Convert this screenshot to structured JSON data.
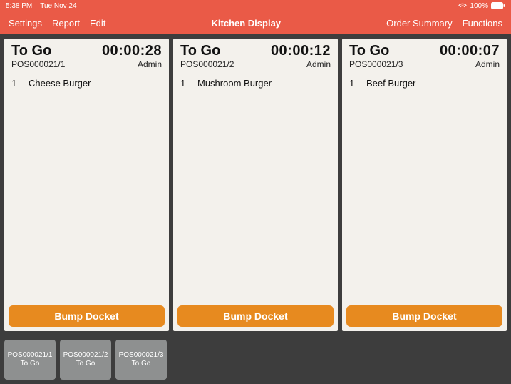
{
  "status": {
    "time": "5:38 PM",
    "date": "Tue Nov 24",
    "battery": "100%"
  },
  "nav": {
    "left": {
      "settings": "Settings",
      "report": "Report",
      "edit": "Edit"
    },
    "title": "Kitchen Display",
    "right": {
      "order_summary": "Order Summary",
      "functions": "Functions"
    }
  },
  "dockets": [
    {
      "type": "To Go",
      "timer": "00:00:28",
      "ref": "POS000021/1",
      "staff": "Admin",
      "items": [
        {
          "qty": "1",
          "name": "Cheese Burger"
        }
      ],
      "button": "Bump Docket"
    },
    {
      "type": "To Go",
      "timer": "00:00:12",
      "ref": "POS000021/2",
      "staff": "Admin",
      "items": [
        {
          "qty": "1",
          "name": "Mushroom Burger"
        }
      ],
      "button": "Bump Docket"
    },
    {
      "type": "To Go",
      "timer": "00:00:07",
      "ref": "POS000021/3",
      "staff": "Admin",
      "items": [
        {
          "qty": "1",
          "name": "Beef Burger"
        }
      ],
      "button": "Bump Docket"
    }
  ],
  "thumbs": [
    {
      "ref": "POS000021/1",
      "type": "To Go"
    },
    {
      "ref": "POS000021/2",
      "type": "To Go"
    },
    {
      "ref": "POS000021/3",
      "type": "To Go"
    }
  ]
}
